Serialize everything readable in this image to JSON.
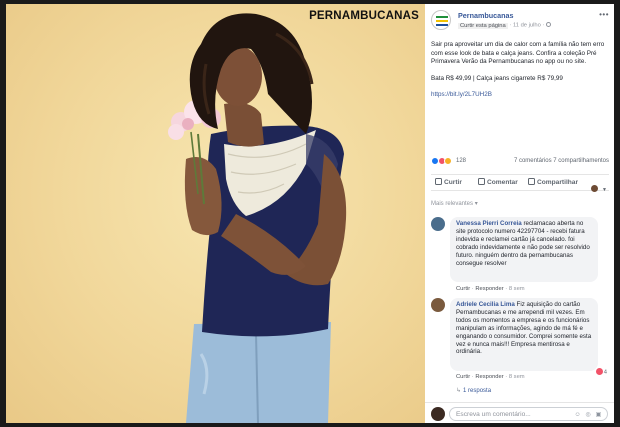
{
  "photo": {
    "brand_text": "PERNAMBUCANAS"
  },
  "post": {
    "page_name": "Pernambucanas",
    "follow_label": "Curtir esta página",
    "date": "11 de julho",
    "more_icon": "ellipsis-icon",
    "paragraphs": [
      "Sair pra aproveitar um dia de calor com a família não tem erro com esse look de bata e calça jeans. Confira a coleção Pré Primavera Verão da Pernambucanas no app ou no site.",
      "Bata R$ 49,99 | Calça jeans cigarrete R$ 79,99"
    ],
    "link": "https://bit.ly/2L7UH2B",
    "reaction_count": "128",
    "comments_shares": "7 comentários   7 compartilhamentos",
    "reaction_colors": [
      "#1877f2",
      "#f25268",
      "#f7b125"
    ],
    "actions": {
      "like": "Curtir",
      "comment": "Comentar",
      "share": "Compartilhar"
    },
    "sort_label": "Mais relevantes",
    "sort_icon": "caret-down-icon"
  },
  "comments": [
    {
      "author": "Vanessa Pierri Correia",
      "text": "reclamacao aberta no site protocolo numero 4229‎7704 - recebi fatura indevida e reclamei cartão já cancelado. foi cobrado indevidamente e não pode ser resolvido futuro. ninguém dentro da pernambucanas consegue resolver",
      "like": "Curtir",
      "reply": "Responder",
      "time": "8 sem",
      "avatar_color": "#4a6d8c"
    },
    {
      "author": "Adriele Cecilia Lima",
      "text": "Fiz aquisição do cartão Pernambucanas e me arrependi mil vezes. Em todos os momentos a empresa e os funcionários manipulam as informações, agindo de má fé e enganando o consumidor. Comprei somente esta vez e nunca mais!!! Empresa mentirosa e ordinária.",
      "like": "Curtir",
      "reply": "Responder",
      "time": "8 sem",
      "reaction_count": "4",
      "avatar_color": "#7a5a3e"
    }
  ],
  "replies_link": "1 resposta",
  "composer": {
    "placeholder": "Escreva um comentário...",
    "tools": "☺ ◎ ▣"
  }
}
